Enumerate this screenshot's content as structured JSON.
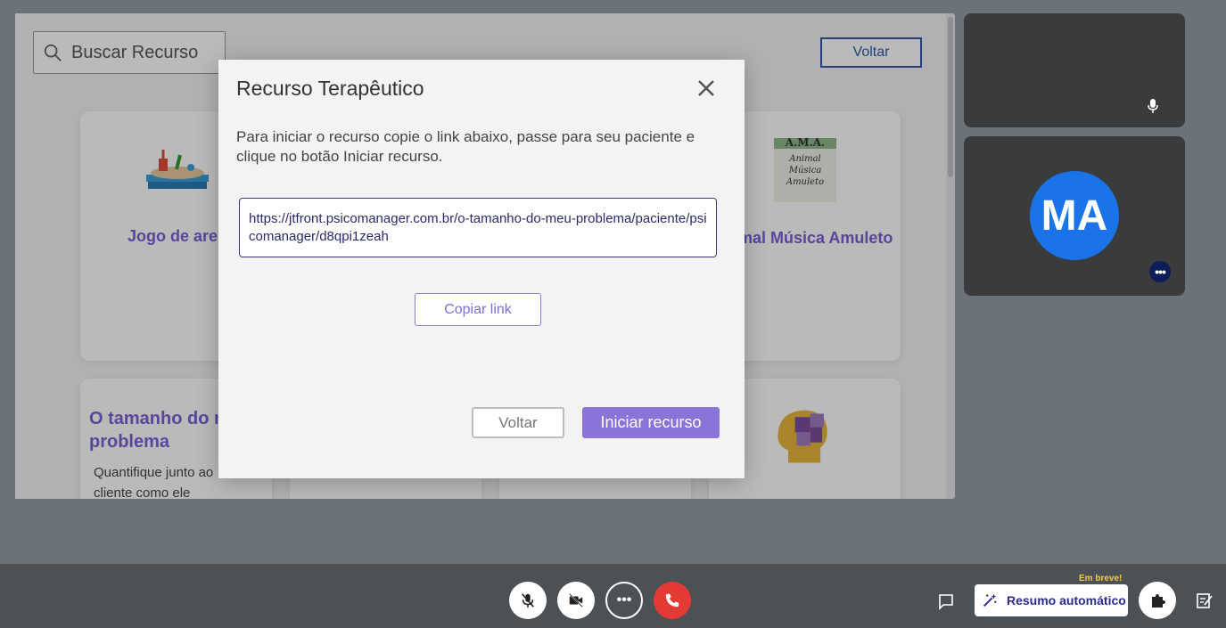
{
  "search": {
    "placeholder": "Buscar Recurso"
  },
  "top": {
    "back_label": "Voltar"
  },
  "cards": {
    "jogo_areia": {
      "title": "Jogo de areia"
    },
    "ama": {
      "title": "Animal Música Amuleto",
      "logo_lines": [
        "A.M.A.",
        "Animal",
        "Música",
        "Amuleto"
      ]
    },
    "tamanho": {
      "title": "O tamanho do meu problema",
      "desc": "Quantifique junto ao cliente como ele"
    }
  },
  "modal": {
    "title": "Recurso Terapêutico",
    "instructions": "Para iniciar o recurso copie o link abaixo, passe para seu paciente e clique no botão Iniciar recurso.",
    "link": "https://jtfront.psicomanager.com.br/o-tamanho-do-meu-problema/paciente/psicomanager/d8qpi1zeah",
    "copy_label": "Copiar link",
    "back_label": "Voltar",
    "start_label": "Iniciar recurso"
  },
  "participants": {
    "tile2_initials": "MA"
  },
  "bottom_bar": {
    "em_breve": "Em breve!",
    "resumo_label": "Resumo automático"
  },
  "colors": {
    "accent": "#8a74d8",
    "card_title": "#7b5fd3",
    "avatar": "#1a73e8",
    "hangup": "#e53935"
  }
}
